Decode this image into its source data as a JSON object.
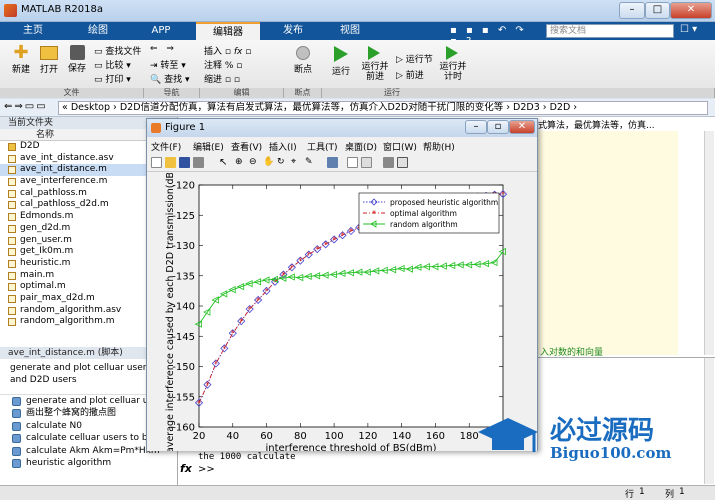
{
  "window": {
    "title": "MATLAB R2018a",
    "minimize": "–",
    "maximize": "□",
    "close": "✕"
  },
  "tabs": [
    "主页",
    "绘图",
    "APP",
    "编辑器",
    "发布",
    "视图"
  ],
  "active_tab": "编辑器",
  "search_placeholder": "搜索文档",
  "ribbon": {
    "file_group": {
      "new": "新建",
      "open": "打开",
      "save": "保存",
      "find_files": "查找文件",
      "compare": "比较",
      "print": "打印",
      "label": "文件"
    },
    "nav_group": {
      "goto": "转至",
      "find": "查找",
      "label": "导航"
    },
    "edit_group": {
      "insert": "插入",
      "comment": "注释",
      "indent": "缩进",
      "label": "编辑"
    },
    "breakpoints_group": {
      "breakpoints": "断点",
      "label": "断点"
    },
    "run_group": {
      "run": "运行",
      "run_advance": "运行并\n前进",
      "run_section": "运行节",
      "advance": "前进",
      "run_time": "运行并\n计时",
      "label": "运行"
    }
  },
  "address": {
    "path": "« Desktop › D2D信道分配仿真，算法有启发式算法，最优算法等，仿真介入D2D对随干扰门限的变化等 › D2D3 › D2D ›"
  },
  "current_folder": {
    "title": "当前文件夹",
    "col_name": "名称",
    "folder": "D2D",
    "files": [
      "ave_int_distance.asv",
      "ave_int_distance.m",
      "ave_interference.m",
      "cal_pathloss.m",
      "cal_pathloss_d2d.m",
      "Edmonds.m",
      "gen_d2d.m",
      "gen_user.m",
      "get_Ik0m.m",
      "heuristic.m",
      "main.m",
      "optimal.m",
      "pair_max_d2d.m",
      "random_algorithm.asv",
      "random_algorithm.m"
    ],
    "selected": "ave_int_distance.m"
  },
  "details": {
    "header": "ave_int_distance.m (脚本)",
    "summary": "generate and plot celluar users and D2D users",
    "items": [
      "generate and plot celluar use",
      "画出整个蜂窝的撒点图",
      "calculate N0",
      "calculate celluar users to bas",
      "calculate Akm  Akm=Pm*Hkm",
      "heuristic algorithm"
    ]
  },
  "editor": {
    "header_text": "式算法，最优算法等，仿真...",
    "comment_text": "入对数的和向量"
  },
  "command": {
    "text": "the 1000 calculate",
    "prompt": ">>"
  },
  "status": {
    "row_label": "行",
    "row": "1",
    "col_label": "列",
    "col": "1"
  },
  "figure": {
    "title": "Figure 1",
    "menu": [
      "文件(F)",
      "编辑(E)",
      "查看(V)",
      "插入(I)",
      "工具(T)",
      "桌面(D)",
      "窗口(W)",
      "帮助(H)"
    ]
  },
  "chart_data": {
    "type": "line",
    "xlabel": "interference threshold of BS(dBm)",
    "ylabel": "average interference caused by each D2D transmission(dBm)",
    "xlim": [
      20,
      200
    ],
    "ylim": [
      -160,
      -120
    ],
    "xticks": [
      20,
      40,
      60,
      80,
      100,
      120,
      140,
      160,
      180
    ],
    "yticks": [
      -160,
      -155,
      -150,
      -145,
      -140,
      -135,
      -130,
      -125,
      -120
    ],
    "x": [
      20,
      25,
      30,
      35,
      40,
      45,
      50,
      55,
      60,
      65,
      70,
      75,
      80,
      85,
      90,
      95,
      100,
      105,
      110,
      115,
      120,
      125,
      130,
      135,
      140,
      145,
      150,
      155,
      160,
      165,
      170,
      175,
      180,
      185,
      190,
      195,
      200
    ],
    "legend": "top-right",
    "series": [
      {
        "name": "proposed heuristic algorithm",
        "color": "#4040d0",
        "values": [
          -156,
          -153,
          -149.5,
          -147,
          -144.5,
          -142.5,
          -140.5,
          -139,
          -137.5,
          -136,
          -134.8,
          -133.6,
          -132.5,
          -131.5,
          -130.6,
          -129.8,
          -129,
          -128.3,
          -127.6,
          -127,
          -126.4,
          -125.9,
          -125.4,
          -124.9,
          -124.5,
          -124.1,
          -123.7,
          -123.4,
          -123.1,
          -122.8,
          -122.5,
          -122.3,
          -122.1,
          -121.9,
          -121.8,
          -121.6,
          -121.5
        ]
      },
      {
        "name": "optimal algorithm",
        "color": "#d02020",
        "values": [
          -156,
          -153,
          -149.5,
          -147,
          -144.5,
          -142.5,
          -140.5,
          -139,
          -137.5,
          -136,
          -134.8,
          -133.6,
          -132.5,
          -131.5,
          -130.6,
          -129.8,
          -129,
          -128.3,
          -127.6,
          -127,
          -126.4,
          -125.9,
          -125.4,
          -124.9,
          -124.5,
          -124.1,
          -123.7,
          -123.4,
          -123.1,
          -122.8,
          -122.5,
          -122.3,
          -122.1,
          -121.9,
          -121.8,
          -121.6,
          -121.5
        ]
      },
      {
        "name": "random algorithm",
        "color": "#20c020",
        "values": [
          -143,
          -141,
          -139,
          -138,
          -137.3,
          -136.8,
          -136.3,
          -136,
          -135.7,
          -135.6,
          -135.4,
          -135.2,
          -135.3,
          -135.1,
          -135,
          -134.9,
          -134.8,
          -134.6,
          -134.5,
          -134.4,
          -134.4,
          -134.2,
          -134.1,
          -134,
          -133.8,
          -133.9,
          -133.6,
          -133.5,
          -133.5,
          -133.4,
          -133.3,
          -133.2,
          -133.2,
          -133.1,
          -133,
          -132.8,
          -131
        ]
      }
    ]
  },
  "watermark": {
    "brand": "必过源码",
    "url": "Biguo100.com"
  }
}
